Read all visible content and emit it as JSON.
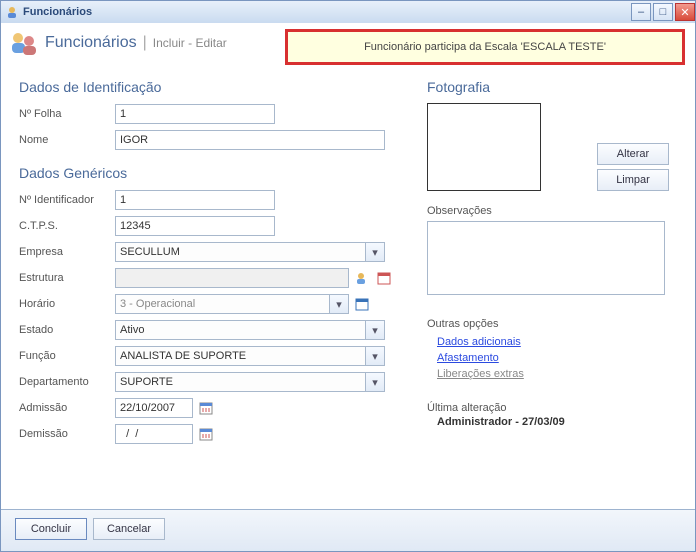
{
  "window": {
    "title": "Funcionários"
  },
  "header": {
    "title": "Funcionários",
    "mode": "Incluir - Editar",
    "message": "Funcionário participa da Escala 'ESCALA TESTE'"
  },
  "sections": {
    "ident": "Dados de Identificação",
    "generic": "Dados Genéricos",
    "photo": "Fotografia",
    "obs": "Observações",
    "other": "Outras opções",
    "lastchange": "Última alteração"
  },
  "labels": {
    "folha": "Nº Folha",
    "nome": "Nome",
    "identificador": "Nº Identificador",
    "ctps": "C.T.P.S.",
    "empresa": "Empresa",
    "estrutura": "Estrutura",
    "horario": "Horário",
    "estado": "Estado",
    "funcao": "Função",
    "departamento": "Departamento",
    "admissao": "Admissão",
    "demissao": "Demissão"
  },
  "values": {
    "folha": "1",
    "nome": "IGOR",
    "identificador": "1",
    "ctps": "12345",
    "empresa": "SECULLUM",
    "estrutura": "",
    "horario": "3 - Operacional",
    "estado": "Ativo",
    "funcao": "ANALISTA DE SUPORTE",
    "departamento": "SUPORTE",
    "admissao": "22/10/2007",
    "demissao": "  /  /",
    "obs": ""
  },
  "links": {
    "dados": "Dados adicionais",
    "afast": "Afastamento",
    "liber": "Liberações extras"
  },
  "lastchange": "Administrador - 27/03/09",
  "buttons": {
    "alterar": "Alterar",
    "limpar": "Limpar",
    "concluir": "Concluir",
    "cancelar": "Cancelar"
  },
  "colors": {
    "highlight_border": "#d83030",
    "highlight_bg": "#ffffe0",
    "link": "#2b4ae0"
  }
}
